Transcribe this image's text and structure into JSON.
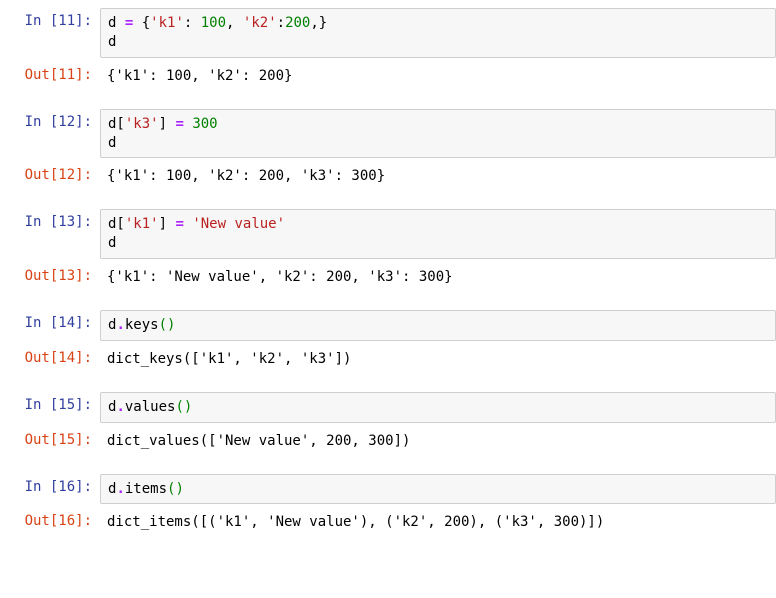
{
  "cells": [
    {
      "n": 11,
      "in_tokens": [
        {
          "t": "d",
          "c": "name"
        },
        {
          "t": " ",
          "c": "punc"
        },
        {
          "t": "=",
          "c": "op"
        },
        {
          "t": " {",
          "c": "punc"
        },
        {
          "t": "'k1'",
          "c": "str"
        },
        {
          "t": ": ",
          "c": "punc"
        },
        {
          "t": "100",
          "c": "num"
        },
        {
          "t": ", ",
          "c": "punc"
        },
        {
          "t": "'k2'",
          "c": "str"
        },
        {
          "t": ":",
          "c": "punc"
        },
        {
          "t": "200",
          "c": "num"
        },
        {
          "t": ",}",
          "c": "punc"
        },
        {
          "t": "\n",
          "c": "punc"
        },
        {
          "t": "d",
          "c": "name"
        }
      ],
      "out_plain": "{'k1': 100, 'k2': 200}"
    },
    {
      "n": 12,
      "in_tokens": [
        {
          "t": "d[",
          "c": "name"
        },
        {
          "t": "'k3'",
          "c": "str"
        },
        {
          "t": "] ",
          "c": "name"
        },
        {
          "t": "=",
          "c": "op"
        },
        {
          "t": " ",
          "c": "punc"
        },
        {
          "t": "300",
          "c": "num"
        },
        {
          "t": "\n",
          "c": "punc"
        },
        {
          "t": "d",
          "c": "name"
        }
      ],
      "out_plain": "{'k1': 100, 'k2': 200, 'k3': 300}"
    },
    {
      "n": 13,
      "in_tokens": [
        {
          "t": "d[",
          "c": "name"
        },
        {
          "t": "'k1'",
          "c": "str"
        },
        {
          "t": "] ",
          "c": "name"
        },
        {
          "t": "=",
          "c": "op"
        },
        {
          "t": " ",
          "c": "punc"
        },
        {
          "t": "'New value'",
          "c": "str"
        },
        {
          "t": "\n",
          "c": "punc"
        },
        {
          "t": "d",
          "c": "name"
        }
      ],
      "out_plain": "{'k1': 'New value', 'k2': 200, 'k3': 300}"
    },
    {
      "n": 14,
      "in_tokens": [
        {
          "t": "d",
          "c": "name"
        },
        {
          "t": ".",
          "c": "op"
        },
        {
          "t": "keys",
          "c": "name"
        },
        {
          "t": "()",
          "c": "paren"
        }
      ],
      "out_plain": "dict_keys(['k1', 'k2', 'k3'])"
    },
    {
      "n": 15,
      "in_tokens": [
        {
          "t": "d",
          "c": "name"
        },
        {
          "t": ".",
          "c": "op"
        },
        {
          "t": "values",
          "c": "name"
        },
        {
          "t": "()",
          "c": "paren"
        }
      ],
      "out_plain": "dict_values(['New value', 200, 300])"
    },
    {
      "n": 16,
      "in_tokens": [
        {
          "t": "d",
          "c": "name"
        },
        {
          "t": ".",
          "c": "op"
        },
        {
          "t": "items",
          "c": "name"
        },
        {
          "t": "()",
          "c": "paren"
        }
      ],
      "out_plain": "dict_items([('k1', 'New value'), ('k2', 200), ('k3', 300)])"
    }
  ],
  "labels": {
    "in_prefix": "In [",
    "out_prefix": "Out[",
    "suffix": "]:"
  }
}
